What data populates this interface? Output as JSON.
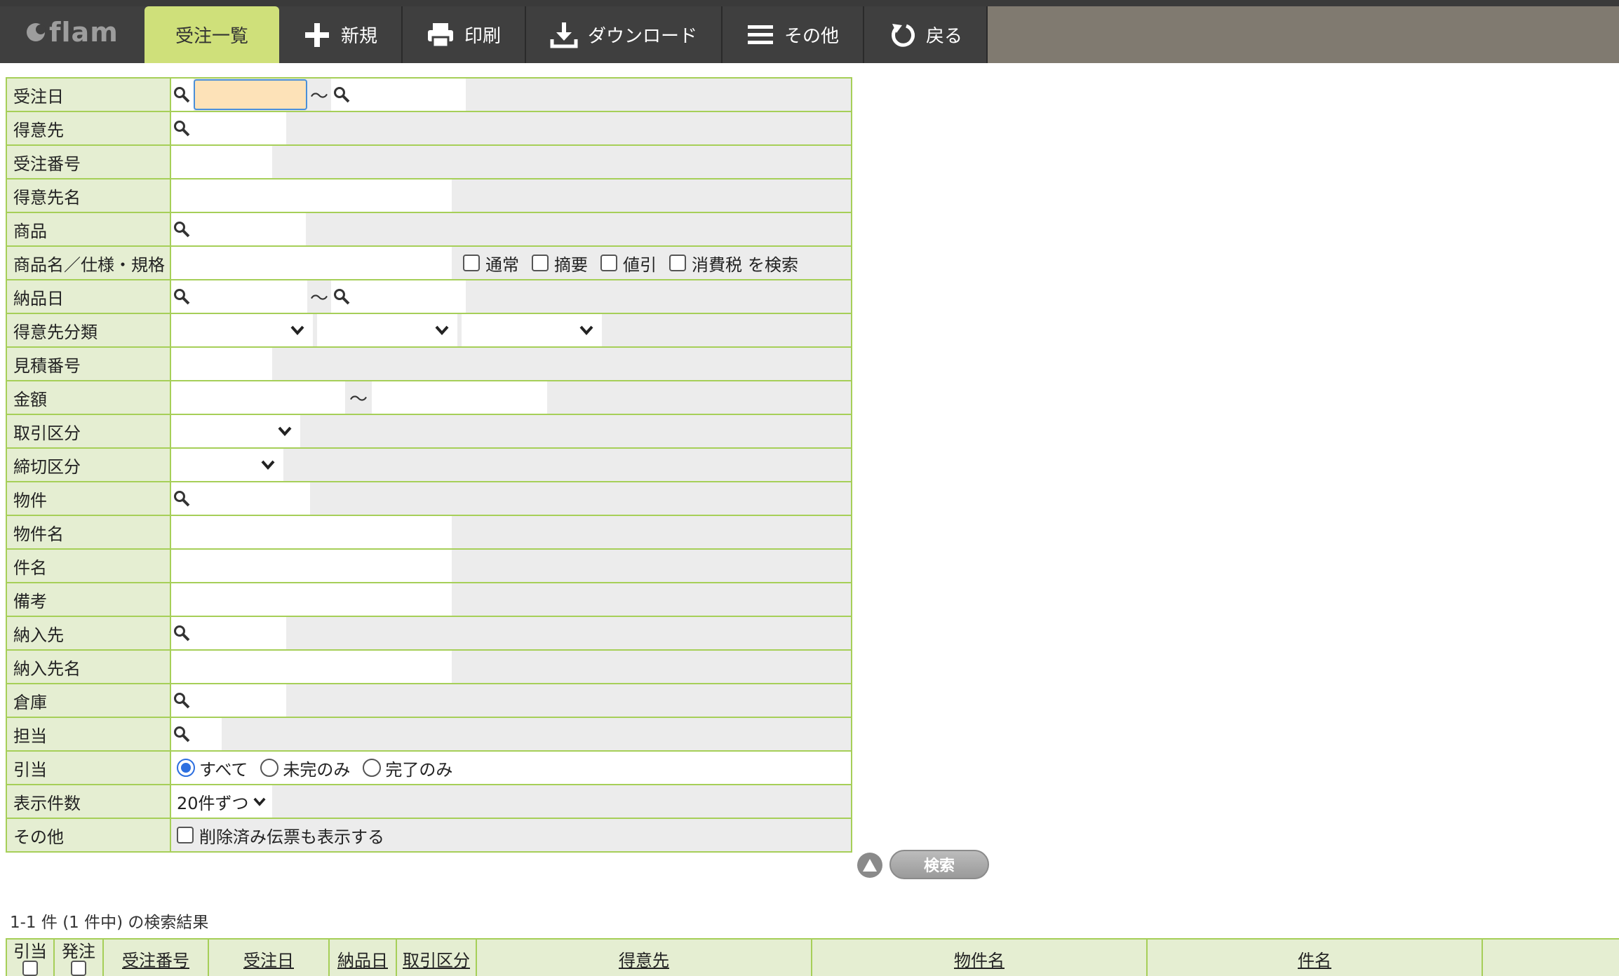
{
  "app": {
    "logo_text": "flam"
  },
  "toolbar": {
    "tabs": [
      {
        "label": "受注一覧",
        "icon": "",
        "active": true
      },
      {
        "label": "新規",
        "icon": "plus-icon"
      },
      {
        "label": "印刷",
        "icon": "printer-icon"
      },
      {
        "label": "ダウンロード",
        "icon": "download-icon"
      },
      {
        "label": "その他",
        "icon": "menu-icon"
      },
      {
        "label": "戻る",
        "icon": "back-icon"
      }
    ]
  },
  "form": {
    "tilde": "〜",
    "rows": {
      "order_date": "受注日",
      "customer": "得意先",
      "order_no": "受注番号",
      "customer_name": "得意先名",
      "product": "商品",
      "product_spec": "商品名／仕様・規格",
      "delivery_date": "納品日",
      "customer_class": "得意先分類",
      "estimate_no": "見積番号",
      "amount": "金額",
      "trade_type": "取引区分",
      "closing_type": "締切区分",
      "property": "物件",
      "property_name": "物件名",
      "subject": "件名",
      "remarks": "備考",
      "delivery_to": "納入先",
      "delivery_to_name": "納入先名",
      "warehouse": "倉庫",
      "staff": "担当",
      "allocation": "引当",
      "display_count": "表示件数",
      "other": "その他"
    },
    "spec_checks": [
      "通常",
      "摘要",
      "値引",
      "消費税"
    ],
    "spec_suffix": "を検索",
    "allocation_options": [
      "すべて",
      "未完のみ",
      "完了のみ"
    ],
    "allocation_selected": "すべて",
    "display_count_value": "20件ずつ",
    "other_check": "削除済み伝票も表示する",
    "search_button": "検索"
  },
  "result_summary": "1-1 件 (1 件中) の検索結果",
  "results": {
    "columns": [
      "引当",
      "発注",
      "受注番号",
      "受注日",
      "納品日",
      "取引区分",
      "得意先",
      "物件名",
      "件名"
    ]
  }
}
